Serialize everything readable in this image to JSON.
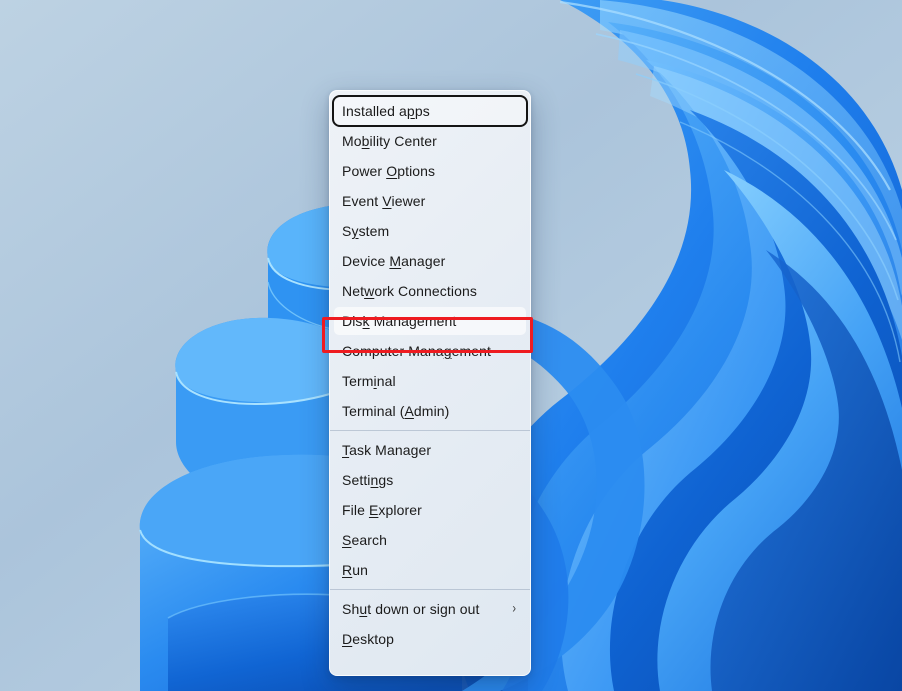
{
  "desktop": {
    "wallpaper_name": "windows-11-bloom-wallpaper",
    "background_color": "#aec6dc"
  },
  "menu": {
    "name": "power-user-menu",
    "items": [
      {
        "id": "installed-apps",
        "label": "Installed apps",
        "access_key": "p",
        "state": "focused",
        "separator_after": false,
        "submenu": false
      },
      {
        "id": "mobility-center",
        "label": "Mobility Center",
        "access_key": "b",
        "state": "normal",
        "separator_after": false,
        "submenu": false
      },
      {
        "id": "power-options",
        "label": "Power Options",
        "access_key": "O",
        "state": "normal",
        "separator_after": false,
        "submenu": false
      },
      {
        "id": "event-viewer",
        "label": "Event Viewer",
        "access_key": "V",
        "state": "normal",
        "separator_after": false,
        "submenu": false
      },
      {
        "id": "system",
        "label": "System",
        "access_key": "y",
        "state": "normal",
        "separator_after": false,
        "submenu": false
      },
      {
        "id": "device-manager",
        "label": "Device Manager",
        "access_key": "M",
        "state": "normal",
        "separator_after": false,
        "submenu": false
      },
      {
        "id": "network-connections",
        "label": "Network Connections",
        "access_key": "w",
        "state": "normal",
        "separator_after": false,
        "submenu": false
      },
      {
        "id": "disk-management",
        "label": "Disk Management",
        "access_key": "k",
        "state": "hovered",
        "separator_after": false,
        "submenu": false
      },
      {
        "id": "computer-management",
        "label": "Computer Management",
        "access_key": "g",
        "state": "normal",
        "separator_after": false,
        "submenu": false
      },
      {
        "id": "terminal",
        "label": "Terminal",
        "access_key": "i",
        "state": "normal",
        "separator_after": false,
        "submenu": false
      },
      {
        "id": "terminal-admin",
        "label": "Terminal (Admin)",
        "access_key": "A",
        "state": "normal",
        "separator_after": true,
        "submenu": false
      },
      {
        "id": "task-manager",
        "label": "Task Manager",
        "access_key": "T",
        "state": "normal",
        "separator_after": false,
        "submenu": false
      },
      {
        "id": "settings",
        "label": "Settings",
        "access_key": "n",
        "state": "normal",
        "separator_after": false,
        "submenu": false
      },
      {
        "id": "file-explorer",
        "label": "File Explorer",
        "access_key": "E",
        "state": "normal",
        "separator_after": false,
        "submenu": false
      },
      {
        "id": "search",
        "label": "Search",
        "access_key": "S",
        "state": "normal",
        "separator_after": false,
        "submenu": false
      },
      {
        "id": "run",
        "label": "Run",
        "access_key": "R",
        "state": "normal",
        "separator_after": true,
        "submenu": false
      },
      {
        "id": "shut-down-or-sign-out",
        "label": "Shut down or sign out",
        "access_key": "u",
        "state": "normal",
        "separator_after": false,
        "submenu": true,
        "submenu_glyph": "›"
      },
      {
        "id": "desktop",
        "label": "Desktop",
        "access_key": "D",
        "state": "normal",
        "separator_after": false,
        "submenu": false
      }
    ]
  },
  "annotation": {
    "name": "red-highlight-box",
    "target_item": "Disk Management",
    "color": "#ee1b20"
  }
}
